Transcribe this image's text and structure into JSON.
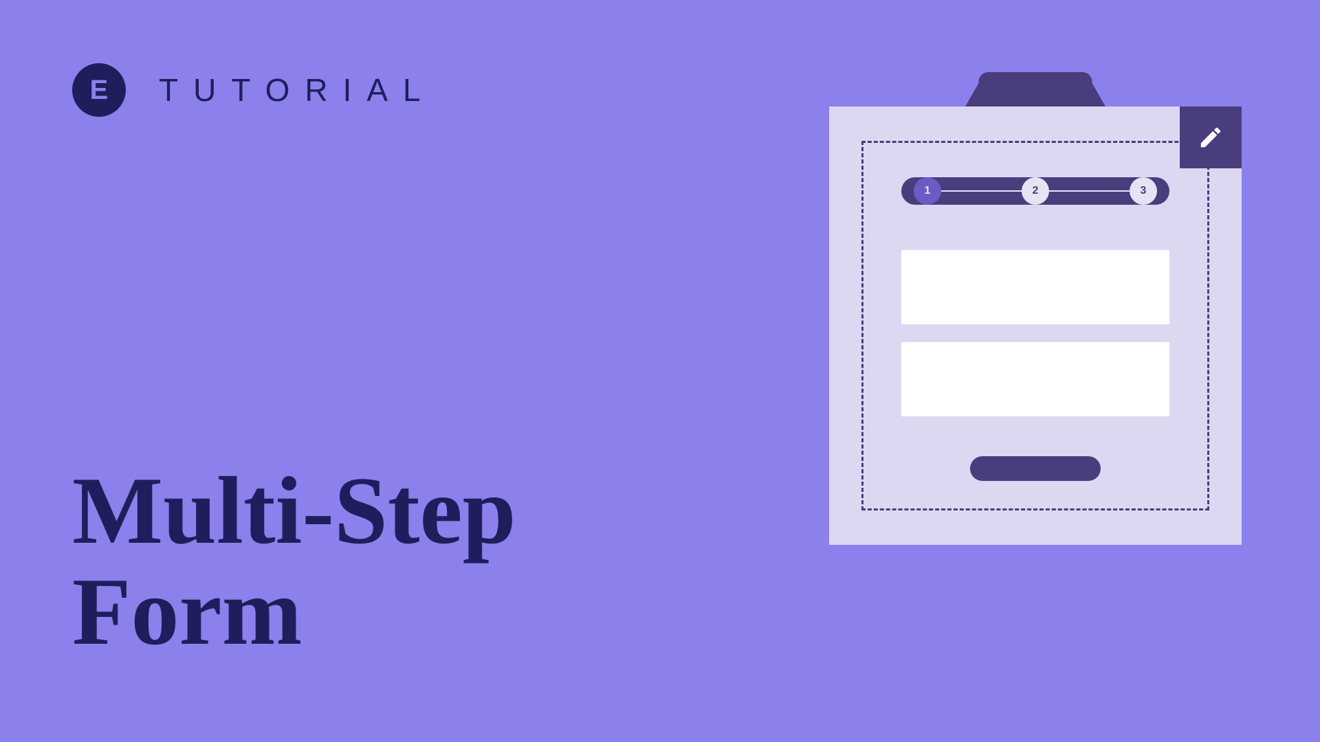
{
  "header": {
    "logo_letter": "E",
    "tutorial_label": "TUTORIAL"
  },
  "title": {
    "line1": "Multi-Step",
    "line2": "Form"
  },
  "form_widget": {
    "steps": [
      "1",
      "2",
      "3"
    ],
    "active_step_index": 0
  }
}
